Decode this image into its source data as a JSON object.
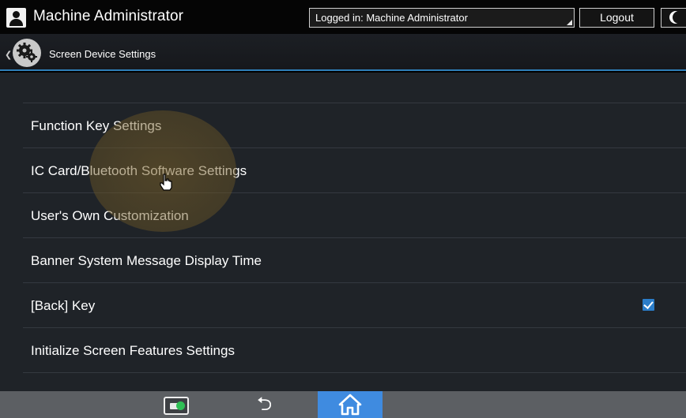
{
  "topbar": {
    "user_name": "Machine Administrator",
    "login_status": "Logged in: Machine Administrator",
    "logout_label": "Logout"
  },
  "header": {
    "title": "Screen Device Settings"
  },
  "settings_list": [
    {
      "label": "Function Key Settings",
      "checked": null
    },
    {
      "label": "IC Card/Bluetooth Software Settings",
      "checked": null
    },
    {
      "label": "User's Own Customization",
      "checked": null
    },
    {
      "label": "Banner System Message Display Time",
      "checked": null
    },
    {
      "label": "[Back] Key",
      "checked": true
    },
    {
      "label": "Initialize Screen Features Settings",
      "checked": null
    }
  ],
  "icons": {
    "user": "user-icon",
    "night_mode": "moon-icon",
    "settings": "gear-icon",
    "card_app": "ic-card-app-icon",
    "back": "back-arrow-icon",
    "home": "home-icon"
  },
  "colors": {
    "accent": "#2f7fb9",
    "home_button": "#3f8be0",
    "checkbox": "#2b7dc9"
  }
}
